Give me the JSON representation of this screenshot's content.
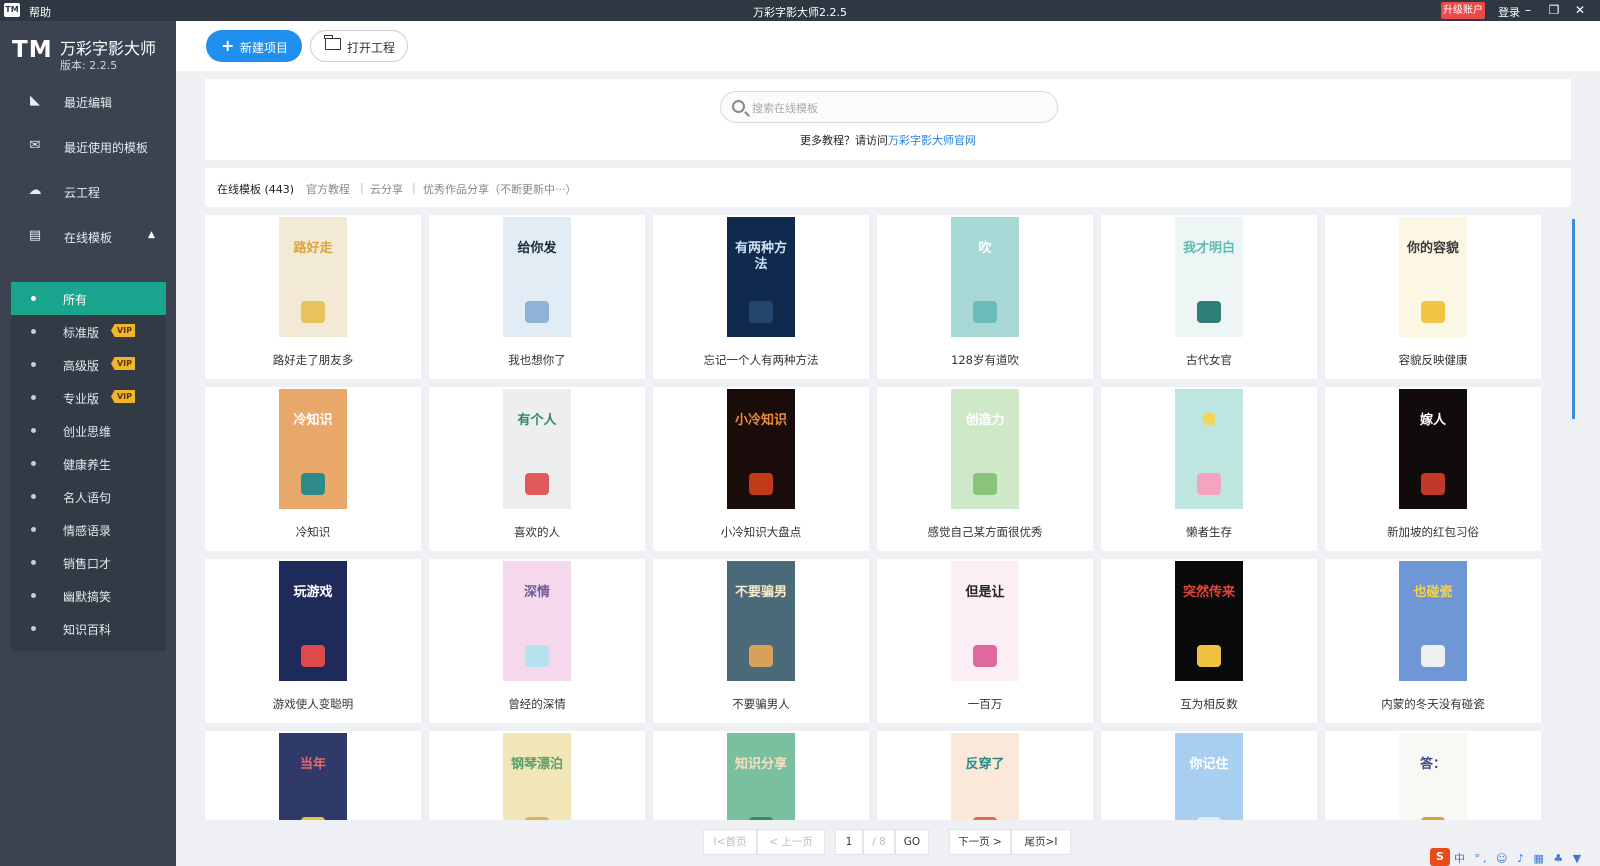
{
  "titlebar": {
    "logo": "TM",
    "help": "帮助",
    "title": "万彩字影大师2.2.5",
    "upgrade": "升级账户",
    "login": "登录",
    "min": "–",
    "restore": "❐",
    "close": "✕"
  },
  "sidebar": {
    "logo": "TM",
    "app_name": "万彩字影大师",
    "version": "版本: 2.2.5",
    "nav": [
      {
        "label": "最近编辑",
        "icon": "file-icon"
      },
      {
        "label": "最近使用的模板",
        "icon": "mail-icon"
      },
      {
        "label": "云工程",
        "icon": "cloud-icon"
      },
      {
        "label": "在线模板",
        "icon": "monitor-icon"
      }
    ],
    "sub": [
      {
        "label": "所有",
        "active": true,
        "vip": false
      },
      {
        "label": "标准版",
        "vip": true
      },
      {
        "label": "高级版",
        "vip": true
      },
      {
        "label": "专业版",
        "vip": true
      },
      {
        "label": "创业思维",
        "vip": false
      },
      {
        "label": "健康养生",
        "vip": false
      },
      {
        "label": "名人语句",
        "vip": false
      },
      {
        "label": "情感语录",
        "vip": false
      },
      {
        "label": "销售口才",
        "vip": false
      },
      {
        "label": "幽默搞笑",
        "vip": false
      },
      {
        "label": "知识百科",
        "vip": false
      }
    ],
    "vip_label": "VIP"
  },
  "toolbar": {
    "new_label": "新建项目",
    "open_label": "打开工程"
  },
  "search": {
    "placeholder": "搜索在线模板",
    "tutorial_prefix": "更多教程？请访问",
    "tutorial_link": "万彩字影大师官网"
  },
  "tabs": [
    {
      "label": "在线模板 (443)",
      "active": true
    },
    {
      "label": "官方教程"
    },
    {
      "label": "云分享"
    },
    {
      "label": "优秀作品分享（不断更新中···）"
    }
  ],
  "templates": [
    {
      "title": "路好走了朋友多",
      "thumb_text": "路好走",
      "bg": "#f3ead6",
      "fg": "#d9a53a",
      "deco": "#e8c25a"
    },
    {
      "title": "我也想你了",
      "thumb_text": "给你发",
      "bg": "#e2ecf5",
      "fg": "#1b2a3a",
      "deco": "#8fb3d8"
    },
    {
      "title": "忘记一个人有两种方法",
      "thumb_text": "有两种方法",
      "bg": "#0f2a4d",
      "fg": "#cfe0f5",
      "deco": "#24466f"
    },
    {
      "title": "128岁有道吹",
      "thumb_text": "吹",
      "bg": "#a8d8d6",
      "fg": "#ffffff",
      "deco": "#6bbcb8"
    },
    {
      "title": "古代女官",
      "thumb_text": "我才明白",
      "bg": "#eef6f5",
      "fg": "#5fbcb0",
      "deco": "#2f7f76"
    },
    {
      "title": "容貌反映健康",
      "thumb_text": "你的容貌",
      "bg": "#fbf7e2",
      "fg": "#3a3a3a",
      "deco": "#f2c443"
    },
    {
      "title": "冷知识",
      "thumb_text": "冷知识",
      "bg": "#e8a86a",
      "fg": "#ffffff",
      "deco": "#2f8a8a"
    },
    {
      "title": "喜欢的人",
      "thumb_text": "有个人",
      "bg": "#eeeeee",
      "fg": "#2f8a6a",
      "deco": "#e05a5a"
    },
    {
      "title": "小冷知识大盘点",
      "thumb_text": "小冷知识",
      "bg": "#1a0c0a",
      "fg": "#f08a3a",
      "deco": "#c03a1a"
    },
    {
      "title": "感觉自己某方面很优秀",
      "thumb_text": "创造力",
      "bg": "#cfe8c8",
      "fg": "#ffffff",
      "deco": "#8ac47a"
    },
    {
      "title": "懒者生存",
      "thumb_text": "懒",
      "bg": "#bde6e0",
      "fg": "#f6d24a",
      "deco": "#f2a4c0"
    },
    {
      "title": "新加坡的红包习俗",
      "thumb_text": "嫁人",
      "bg": "#120b0b",
      "fg": "#ffffff",
      "deco": "#c0392b"
    },
    {
      "title": "游戏使人变聪明",
      "thumb_text": "玩游戏",
      "bg": "#1e2a5a",
      "fg": "#ffffff",
      "deco": "#e04a4a"
    },
    {
      "title": "曾经的深情",
      "thumb_text": "深情",
      "bg": "#f5d8ec",
      "fg": "#6a5aa0",
      "deco": "#b6e2f0"
    },
    {
      "title": "不要骗男人",
      "thumb_text": "不要骗男",
      "bg": "#4a6a7a",
      "fg": "#f6e8c8",
      "deco": "#d9a05a"
    },
    {
      "title": "一百万",
      "thumb_text": "但是让",
      "bg": "#fbeef4",
      "fg": "#222222",
      "deco": "#e06aa0"
    },
    {
      "title": "互为相反数",
      "thumb_text": "突然传来",
      "bg": "#0a0a0a",
      "fg": "#e0453a",
      "deco": "#f0c040"
    },
    {
      "title": "内蒙的冬天没有碰瓷",
      "thumb_text": "也碰瓷",
      "bg": "#6f97d6",
      "fg": "#f6d24a",
      "deco": "#f0f0f0"
    },
    {
      "title": "",
      "thumb_text": "当年",
      "bg": "#2f3a6a",
      "fg": "#e06a6a",
      "deco": "#f0c040"
    },
    {
      "title": "",
      "thumb_text": "钢琴漂泊",
      "bg": "#f0e6b8",
      "fg": "#5aa06a",
      "deco": "#e0b060"
    },
    {
      "title": "",
      "thumb_text": "知识分享",
      "bg": "#7ac0a0",
      "fg": "#f6e0c0",
      "deco": "#3a8a6a"
    },
    {
      "title": "",
      "thumb_text": "反穿了",
      "bg": "#fbe8d8",
      "fg": "#2a8a8a",
      "deco": "#e06a4a"
    },
    {
      "title": "",
      "thumb_text": "你记住",
      "bg": "#a8cef0",
      "fg": "#ffffff",
      "deco": "#e0f0fa"
    },
    {
      "title": "",
      "thumb_text": "答：",
      "bg": "#f8f8f4",
      "fg": "#3a4a8a",
      "deco": "#e0a03a"
    }
  ],
  "pagination": {
    "first": "I<首页",
    "prev": "< 上一页",
    "current": "1",
    "total": "/ 8",
    "go": "GO",
    "next": "下一页 >",
    "last": "尾页>I"
  },
  "tray": {
    "s": "S",
    "icons": "中 °, ☺ ♪ ▦ ♣ ▼ ▤"
  }
}
